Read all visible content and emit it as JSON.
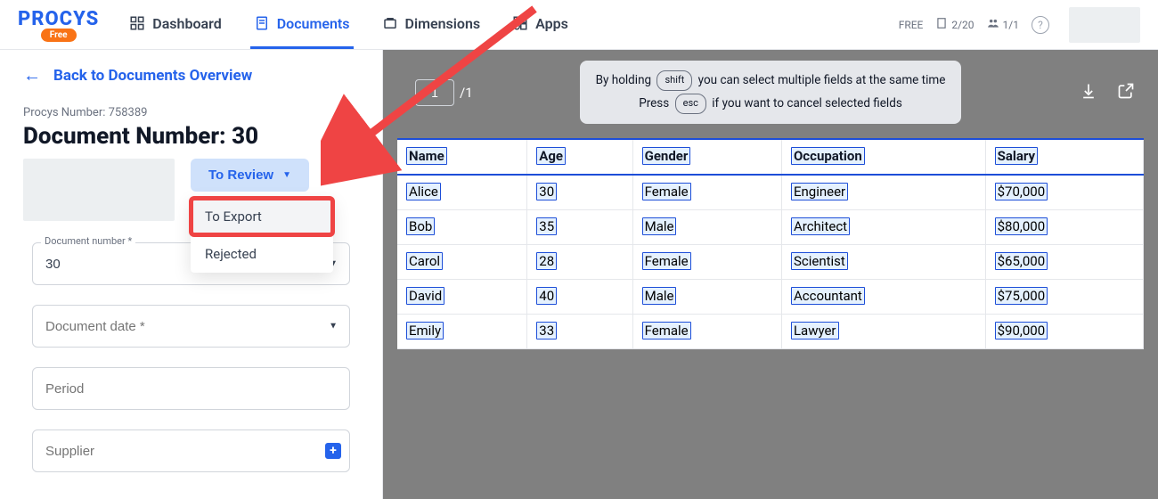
{
  "brand": {
    "name": "PROCYS",
    "badge": "Free"
  },
  "nav": {
    "items": [
      {
        "label": "Dashboard"
      },
      {
        "label": "Documents"
      },
      {
        "label": "Dimensions"
      },
      {
        "label": "Apps"
      }
    ],
    "activeIndex": 1
  },
  "topStatus": {
    "plan": "FREE",
    "docCount": "2/20",
    "userCount": "1/1"
  },
  "left": {
    "backLabel": "Back to Documents Overview",
    "procysNumberLabel": "Procys Number:",
    "procysNumber": "758389",
    "docTitlePrefix": "Document Number:",
    "docNumber": "30",
    "status": {
      "current": "To Review",
      "options": [
        {
          "label": "To Export"
        },
        {
          "label": "Rejected"
        }
      ]
    },
    "fields": {
      "docNumber": {
        "label": "Document number *",
        "value": "30"
      },
      "docDate": {
        "label": "Document date *",
        "value": ""
      },
      "period": {
        "label": "Period",
        "value": ""
      },
      "supplier": {
        "label": "Supplier",
        "value": ""
      }
    }
  },
  "viewer": {
    "page": "1",
    "totalPages": "/1",
    "hintLine1a": "By holding",
    "hintKey1": "shift",
    "hintLine1b": "you can select multiple fields at the same time",
    "hintLine2a": "Press",
    "hintKey2": "esc",
    "hintLine2b": "if you want to cancel selected fields"
  },
  "table": {
    "headers": [
      "Name",
      "Age",
      "Gender",
      "Occupation",
      "Salary"
    ],
    "rows": [
      [
        "Alice",
        "30",
        "Female",
        "Engineer",
        "$70,000"
      ],
      [
        "Bob",
        "35",
        "Male",
        "Architect",
        "$80,000"
      ],
      [
        "Carol",
        "28",
        "Female",
        "Scientist",
        "$65,000"
      ],
      [
        "David",
        "40",
        "Male",
        "Accountant",
        "$75,000"
      ],
      [
        "Emily",
        "33",
        "Female",
        "Lawyer",
        "$90,000"
      ]
    ]
  }
}
